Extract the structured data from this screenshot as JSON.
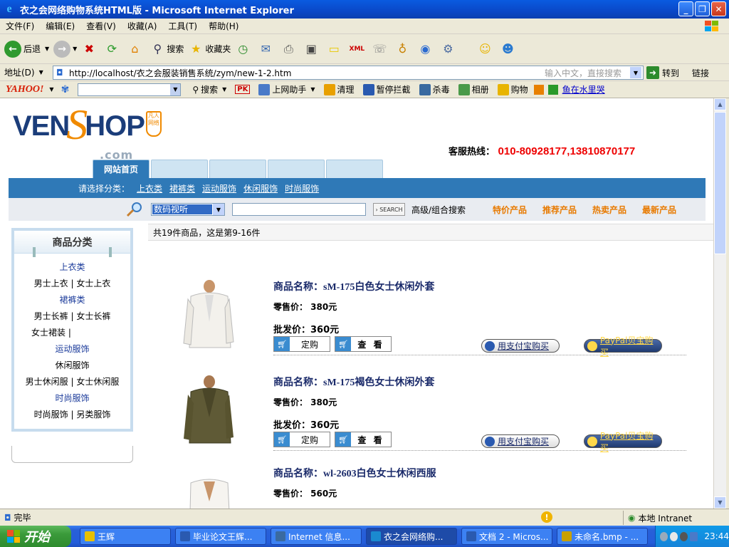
{
  "window": {
    "title": "衣之会网络购物系统HTML版 - Microsoft Internet Explorer"
  },
  "menu": [
    "文件(F)",
    "编辑(E)",
    "查看(V)",
    "收藏(A)",
    "工具(T)",
    "帮助(H)"
  ],
  "toolbar": {
    "back": "后退",
    "search": "搜索",
    "favorites": "收藏夹"
  },
  "address": {
    "label": "地址(D)",
    "url": "http://localhost/衣之会服装销售系统/zym/new-1-2.htm",
    "hint": "输入中文，直接搜索",
    "go": "转到",
    "links": "链接"
  },
  "yahoo": {
    "logo": "YAHOO!",
    "search": "搜索",
    "pk": "PK",
    "items": [
      "上网助手",
      "清理",
      "暂停拦截",
      "杀毒",
      "相册",
      "购物"
    ],
    "link": "鱼在水里哭"
  },
  "site": {
    "logo_v": "VEN",
    "logo_s": "S",
    "logo_hop": "HOP",
    "logo_badge": "凡人网络",
    "logo_com": ".com",
    "hotline_label": "客服热线：",
    "hotline_number": "010-80928177,13810870177",
    "home_tab": "网站首页",
    "category_prompt": "请选择分类：",
    "categories": [
      "上衣类",
      "裙裤类",
      "运动服饰",
      "休闲服饰",
      "时尚服饰"
    ],
    "search_select": "数码视听",
    "search_button": "SEARCH",
    "advanced_search": "高级/组合搜索",
    "product_links": [
      "特价产品",
      "推荐产品",
      "热卖产品",
      "最新产品"
    ],
    "result_info": "共19件商品，这是第9-16件"
  },
  "sidebar": {
    "title": "商品分类",
    "rows": [
      {
        "text": "上衣类",
        "type": "cat"
      },
      {
        "text": "男士上衣 | 女士上衣",
        "type": "item"
      },
      {
        "text": "裙裤类",
        "type": "cat"
      },
      {
        "text": "男士长裤 | 女士长裤",
        "type": "item"
      },
      {
        "text": "女士裙装 |",
        "type": "left"
      },
      {
        "text": "运动服饰",
        "type": "cat"
      },
      {
        "text": "休闲服饰",
        "type": "item"
      },
      {
        "text": "男士休闲服 | 女士休闲服",
        "type": "item"
      },
      {
        "text": "时尚服饰",
        "type": "cat"
      },
      {
        "text": "时尚服饰 | 另类服饰",
        "type": "item"
      }
    ]
  },
  "products": [
    {
      "name": "商品名称：sM-175白色女士休闲外套",
      "retail": "零售价： 380元",
      "wholesale": "批发价：360元",
      "color": "#f3f1ec"
    },
    {
      "name": "商品名称：sM-175褐色女士休闲外套",
      "retail": "零售价： 380元",
      "wholesale": "批发价：360元",
      "color": "#5f5a36"
    },
    {
      "name": "商品名称：wl-2603白色女士休闲西服",
      "retail": "零售价： 560元",
      "wholesale": "",
      "color": "#f6f4f0"
    }
  ],
  "buttons": {
    "order": "定购",
    "view": "查 看",
    "alipay": "用支付宝购买",
    "paypal": "PayPal贝宝购买"
  },
  "status": {
    "text": "完毕",
    "zone": "本地 Intranet"
  },
  "taskbar": {
    "start": "开始",
    "tasks": [
      "王辉",
      "毕业论文王辉...",
      "Internet 信息...",
      "衣之会网络购...",
      "文档 2 - Micros...",
      "未命名.bmp - ..."
    ],
    "active_index": 3,
    "clock": "23:44"
  },
  "colors": {
    "site_blue": "#2f79b7",
    "hotline_red": "#e00000",
    "accent_orange": "#e87a00"
  }
}
